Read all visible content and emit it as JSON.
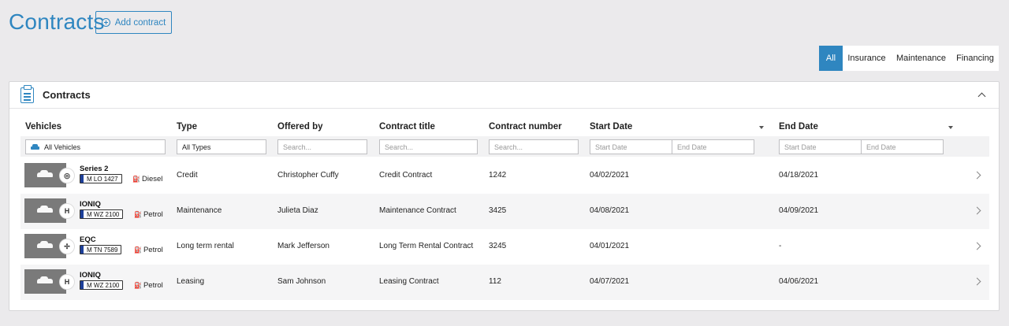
{
  "page": {
    "title": "Contracts",
    "add_label": "Add contract"
  },
  "filters": {
    "tabs": [
      "All",
      "Insurance",
      "Maintenance",
      "Financing"
    ],
    "active": "All"
  },
  "panel": {
    "title": "Contracts"
  },
  "columns": [
    "Vehicles",
    "Type",
    "Offered by",
    "Contract title",
    "Contract number",
    "Start Date",
    "End Date"
  ],
  "filter_inputs": {
    "vehicles": "All Vehicles",
    "type": "All Types",
    "offered_by_placeholder": "Search...",
    "title_placeholder": "Search...",
    "number_placeholder": "Search...",
    "start_from_placeholder": "Start Date",
    "start_to_placeholder": "End Date",
    "end_from_placeholder": "Start Date",
    "end_to_placeholder": "End Date"
  },
  "rows": [
    {
      "model": "Series 2",
      "brand_icon": "bmw-logo",
      "plate": "M LO 1427",
      "fuel": "Diesel",
      "type": "Credit",
      "offered_by": "Christopher Cuffy",
      "title": "Credit Contract",
      "number": "1242",
      "start": "04/02/2021",
      "end": "04/18/2021"
    },
    {
      "model": "IONIQ",
      "brand_icon": "hyundai-logo",
      "plate": "M WZ 2100",
      "fuel": "Petrol",
      "type": "Maintenance",
      "offered_by": "Julieta Diaz",
      "title": "Maintenance Contract",
      "number": "3425",
      "start": "04/08/2021",
      "end": "04/09/2021"
    },
    {
      "model": "EQC",
      "brand_icon": "mercedes-logo",
      "plate": "M TN 7589",
      "fuel": "Petrol",
      "type": "Long term rental",
      "offered_by": "Mark Jefferson",
      "title": "Long Term Rental Contract",
      "number": "3245",
      "start": "04/01/2021",
      "end": "-"
    },
    {
      "model": "IONIQ",
      "brand_icon": "hyundai-logo",
      "plate": "M WZ 2100",
      "fuel": "Petrol",
      "type": "Leasing",
      "offered_by": "Sam Johnson",
      "title": "Leasing Contract",
      "number": "112",
      "start": "04/07/2021",
      "end": "04/06/2021"
    }
  ],
  "colors": {
    "accent": "#2f86c0",
    "background": "#ebeaec",
    "row_alt": "#f5f5f6"
  }
}
